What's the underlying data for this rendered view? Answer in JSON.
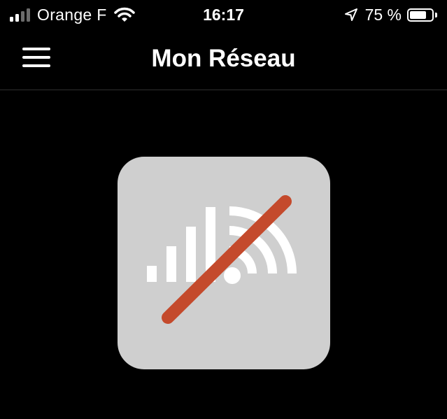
{
  "status_bar": {
    "carrier": "Orange F",
    "time": "16:17",
    "battery_percent": "75 %",
    "battery_level": 0.75,
    "signal_bars": 4,
    "signal_bars_filled": 2,
    "icons": [
      "signal-bars-icon",
      "wifi-icon",
      "location-arrow-icon",
      "battery-icon"
    ]
  },
  "nav": {
    "title": "Mon Réseau",
    "menu_icon": "hamburger-menu-icon"
  },
  "network_tile": {
    "icon": "network-disconnected-icon",
    "tile_color": "#cfcfcf",
    "glyph_color": "#ffffff",
    "strike_color": "#c44a2c"
  },
  "colors": {
    "background": "#000000",
    "text": "#ffffff",
    "divider": "#2f2f2f"
  }
}
